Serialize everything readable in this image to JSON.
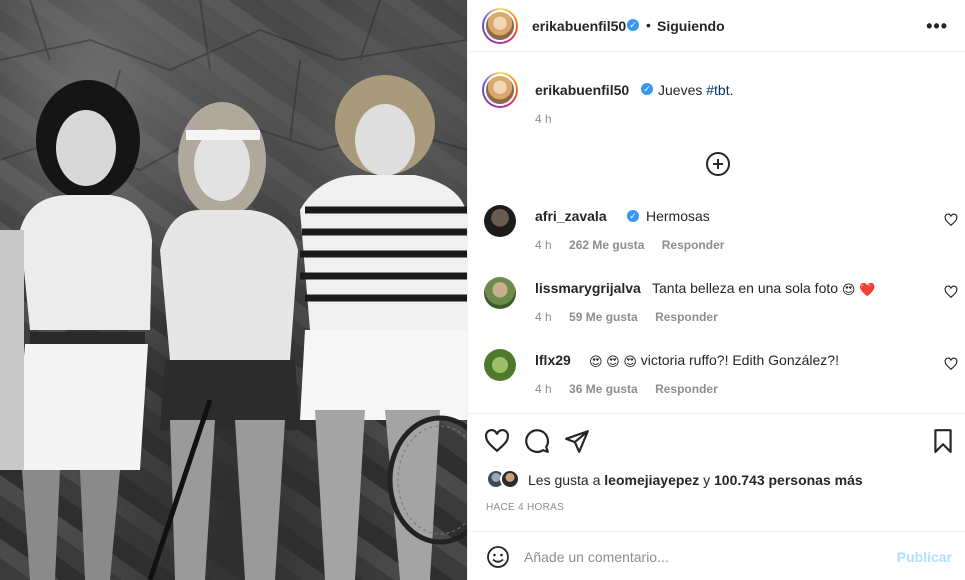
{
  "post": {
    "author": "erikabuenfil50",
    "follow_separator": "•",
    "follow_status": "Siguiendo",
    "more_icon": "more-horizontal-icon",
    "caption_text": "Jueves ",
    "caption_hashtag": "#tbt",
    "caption_end": ".",
    "caption_time": "4 h"
  },
  "comments": [
    {
      "user": "afri_zavala",
      "verified": true,
      "text": "Hermosas",
      "time": "4 h",
      "likes": "262 Me gusta",
      "reply": "Responder"
    },
    {
      "user": "lissmarygrijalva",
      "verified": false,
      "text": "Tanta belleza en una sola foto",
      "emojis": "😍",
      "emoji2": "❤️",
      "time": "4 h",
      "likes": "59 Me gusta",
      "reply": "Responder"
    },
    {
      "user": "lflx29",
      "verified": false,
      "emojis": "😍 😍 😍",
      "text": "victoria ruffo?! Edith González?!",
      "time": "4 h",
      "likes": "36 Me gusta",
      "reply": "Responder"
    }
  ],
  "likes": {
    "prefix": "Les gusta a ",
    "user": "leomejiayepez",
    "middle": " y ",
    "count": "100.743 personas más"
  },
  "posted": "HACE 4 HORAS",
  "add_comment": {
    "placeholder": "Añade un comentario...",
    "publish": "Publicar"
  },
  "colors": {
    "verified": "#3897f0",
    "hashtag": "#00376b",
    "muted": "#8e8e8e",
    "publish_disabled": "#b2dffc"
  }
}
